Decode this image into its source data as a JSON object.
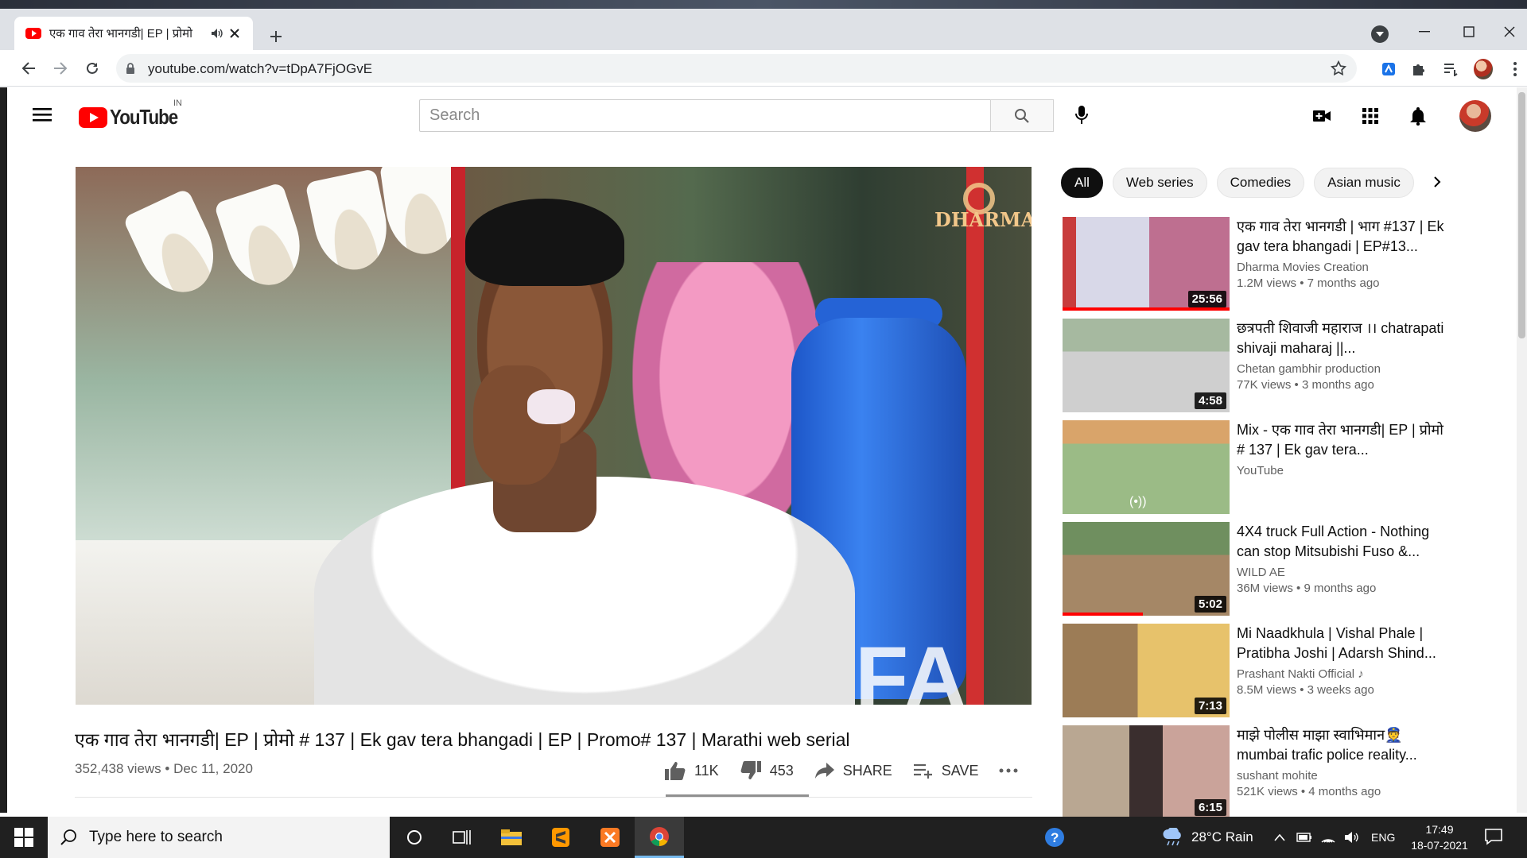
{
  "browser": {
    "tab_title": "एक गाव तेरा भानगडी| EP | प्रोमो",
    "url": "youtube.com/watch?v=tDpA7FjOGvE"
  },
  "masthead": {
    "logo_text": "YouTube",
    "country_code": "IN",
    "search_placeholder": "Search"
  },
  "video": {
    "watermark": "DHARMA",
    "title": "एक गाव तेरा भानगडी| EP | प्रोमो # 137 | Ek gav tera bhangadi | EP | Promo# 137 | Marathi web serial",
    "meta": "352,438 views • Dec 11, 2020",
    "likes": "11K",
    "dislikes": "453",
    "share_label": "SHARE",
    "save_label": "SAVE"
  },
  "chips": [
    "All",
    "Web series",
    "Comedies",
    "Asian music"
  ],
  "recommendations": [
    {
      "title": "एक गाव तेरा भानगडी | भाग #137 | Ek gav tera bhangadi | EP#13...",
      "channel": "Dharma Movies Creation",
      "stats": "1.2M views • 7 months ago",
      "duration": "25:56"
    },
    {
      "title": "छत्रपती शिवाजी महाराज ।। chatrapati shivaji maharaj ||...",
      "channel": "Chetan gambhir production",
      "stats": "77K views • 3 months ago",
      "duration": "4:58"
    },
    {
      "title": "Mix - एक गाव तेरा भानगडी| EP | प्रोमो # 137 | Ek gav tera...",
      "channel": "YouTube",
      "stats": "",
      "duration": ""
    },
    {
      "title": "4X4 truck Full Action - Nothing can stop Mitsubishi Fuso &...",
      "channel": "WILD AE",
      "stats": "36M views • 9 months ago",
      "duration": "5:02"
    },
    {
      "title": "Mi Naadkhula | Vishal Phale | Pratibha Joshi | Adarsh Shind...",
      "channel": "Prashant Nakti Official ♪",
      "stats": "8.5M views • 3 weeks ago",
      "duration": "7:13"
    },
    {
      "title": "माझे पोलीस माझा स्वाभिमान👮 mumbai trafic police reality...",
      "channel": "sushant mohite",
      "stats": "521K views • 4 months ago",
      "duration": "6:15"
    }
  ],
  "taskbar": {
    "search_placeholder": "Type here to search",
    "weather": "28°C  Rain",
    "language": "ENG",
    "time": "17:49",
    "date": "18-07-2021"
  }
}
